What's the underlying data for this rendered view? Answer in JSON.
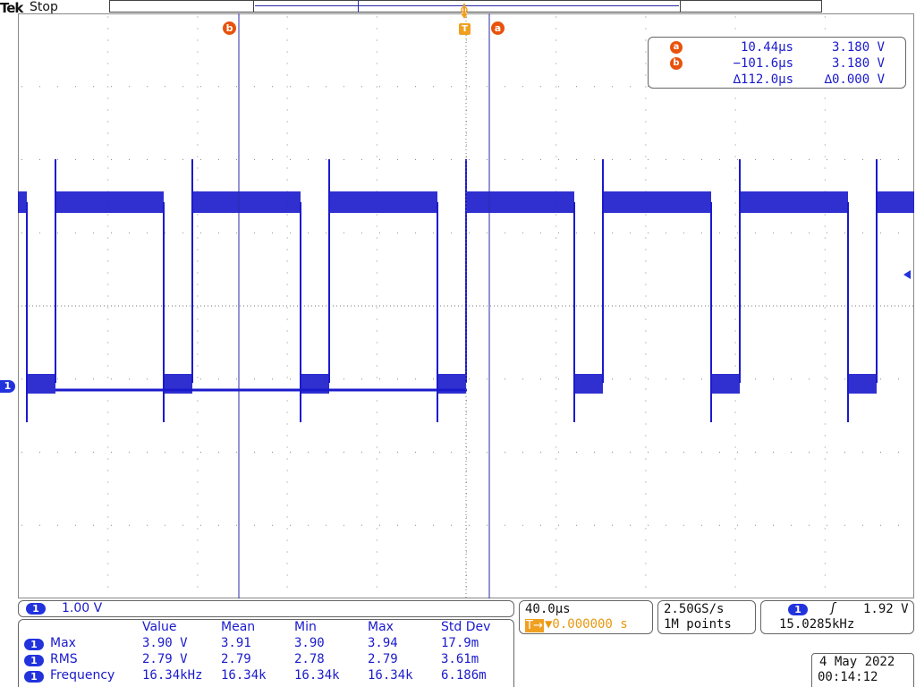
{
  "header": {
    "brand": "Tek",
    "acq_status": "Stop"
  },
  "markers": {
    "cursor_a": "a",
    "cursor_b": "b",
    "trigger": "T",
    "channel": "1"
  },
  "cursor_readout": {
    "a": {
      "label": "a",
      "time": "10.44µs",
      "value": "3.180 V"
    },
    "b": {
      "label": "b",
      "time": "−101.6µs",
      "value": "3.180 V"
    },
    "delta": {
      "time": "∆112.0µs",
      "value": "∆0.000 V"
    }
  },
  "channel_panel": {
    "channel": "1",
    "scale": "1.00 V"
  },
  "timebase_panel": {
    "scale": "40.0µs",
    "trigger_position": "▼0.000000 s",
    "trigger_icon": "T→"
  },
  "acquisition_panel": {
    "sample_rate": "2.50GS/s",
    "record_length": "1M points"
  },
  "trigger_panel": {
    "channel": "1",
    "slope_icon": "rising-edge-icon",
    "slope_glyph": "ʃ",
    "level": "1.92 V",
    "frequency": "15.0285kHz"
  },
  "measurements": {
    "headers": [
      "Value",
      "Mean",
      "Min",
      "Max",
      "Std Dev"
    ],
    "rows": [
      {
        "channel": "1",
        "name": "Max",
        "cells": [
          "3.90 V",
          "3.91",
          "3.90",
          "3.94",
          "17.9m"
        ]
      },
      {
        "channel": "1",
        "name": "RMS",
        "cells": [
          "2.79 V",
          "2.79",
          "2.78",
          "2.79",
          "3.61m"
        ]
      },
      {
        "channel": "1",
        "name": "Frequency",
        "cells": [
          "16.34kHz",
          "16.34k",
          "16.34k",
          "16.34k",
          "6.186m"
        ]
      }
    ]
  },
  "datetime": {
    "date": "4 May 2022",
    "time": "00:14:12"
  },
  "colors": {
    "trace": "#1a1acc",
    "cursor": "#2a2aaa",
    "cursor_marker": "#e8520c",
    "trigger_marker": "#f0a020"
  }
}
